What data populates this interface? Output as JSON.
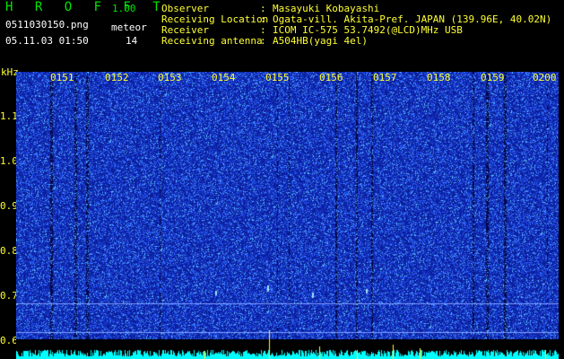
{
  "header": {
    "brand": "H R O F F T",
    "version": "1.00",
    "filename": "0511030150.png",
    "meteor_label": "meteor",
    "datetime": "05.11.03 01:50",
    "meteor_count": "14"
  },
  "info": [
    {
      "label": "Observer",
      "value": "Masayuki Kobayashi"
    },
    {
      "label": "Receiving Location",
      "value": "Ogata-vill. Akita-Pref. JAPAN (139.96E, 40.02N)"
    },
    {
      "label": "Receiver",
      "value": "ICOM IC-575 53.7492(@LCD)MHz USB"
    },
    {
      "label": "Receiving antenna",
      "value": "A504HB(yagi 4el)"
    }
  ],
  "spectrogram": {
    "y_unit": "kHz",
    "y_ticks": [
      "1.1",
      "1.0",
      "0.9",
      "0.8",
      "0.7",
      "0.6"
    ],
    "x_ticks": [
      "0151",
      "0152",
      "0153",
      "0154",
      "0155",
      "0156",
      "0157",
      "0158",
      "0159",
      "0200"
    ],
    "colors": {
      "background": "#0b1e9c",
      "noise": "#2f63ff",
      "bright": "#7fd0ff",
      "trace": "#00ffff",
      "meteor": "#ffff33"
    }
  }
}
